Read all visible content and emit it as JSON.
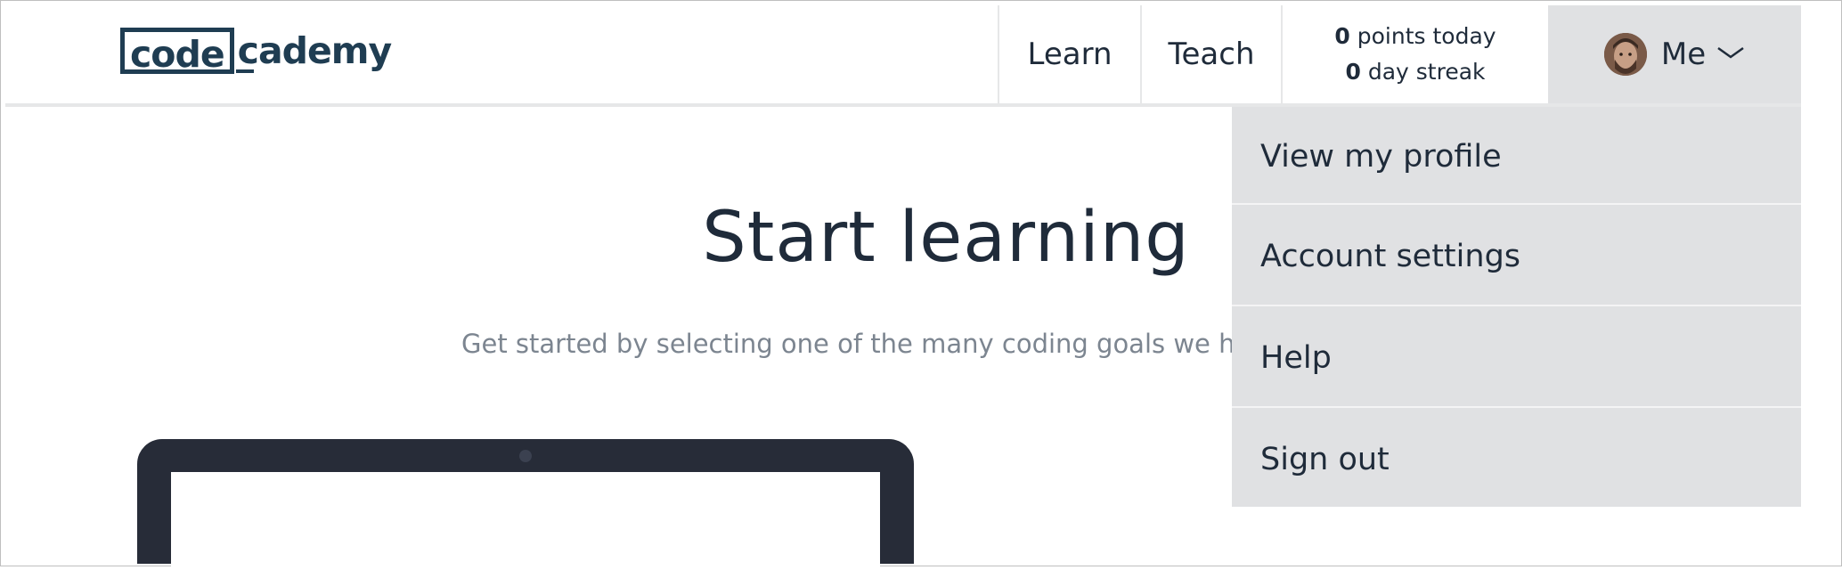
{
  "logo": {
    "left": "code",
    "right": "cademy"
  },
  "nav": {
    "learn": "Learn",
    "teach": "Teach"
  },
  "stats": {
    "points_value": "0",
    "points_label": "points today",
    "streak_value": "0",
    "streak_label": "day streak"
  },
  "user_menu": {
    "label": "Me",
    "items": [
      {
        "label": "View my profile"
      },
      {
        "label": "Account settings"
      },
      {
        "label": "Help"
      },
      {
        "label": "Sign out"
      }
    ]
  },
  "main": {
    "title": "Start learning",
    "subtitle": "Get started by selecting one of the many coding goals we have"
  },
  "colors": {
    "brand": "#1f3d52",
    "text": "#1f2b3a",
    "dropdown_bg": "#e0e1e3",
    "laptop": "#272c38"
  }
}
